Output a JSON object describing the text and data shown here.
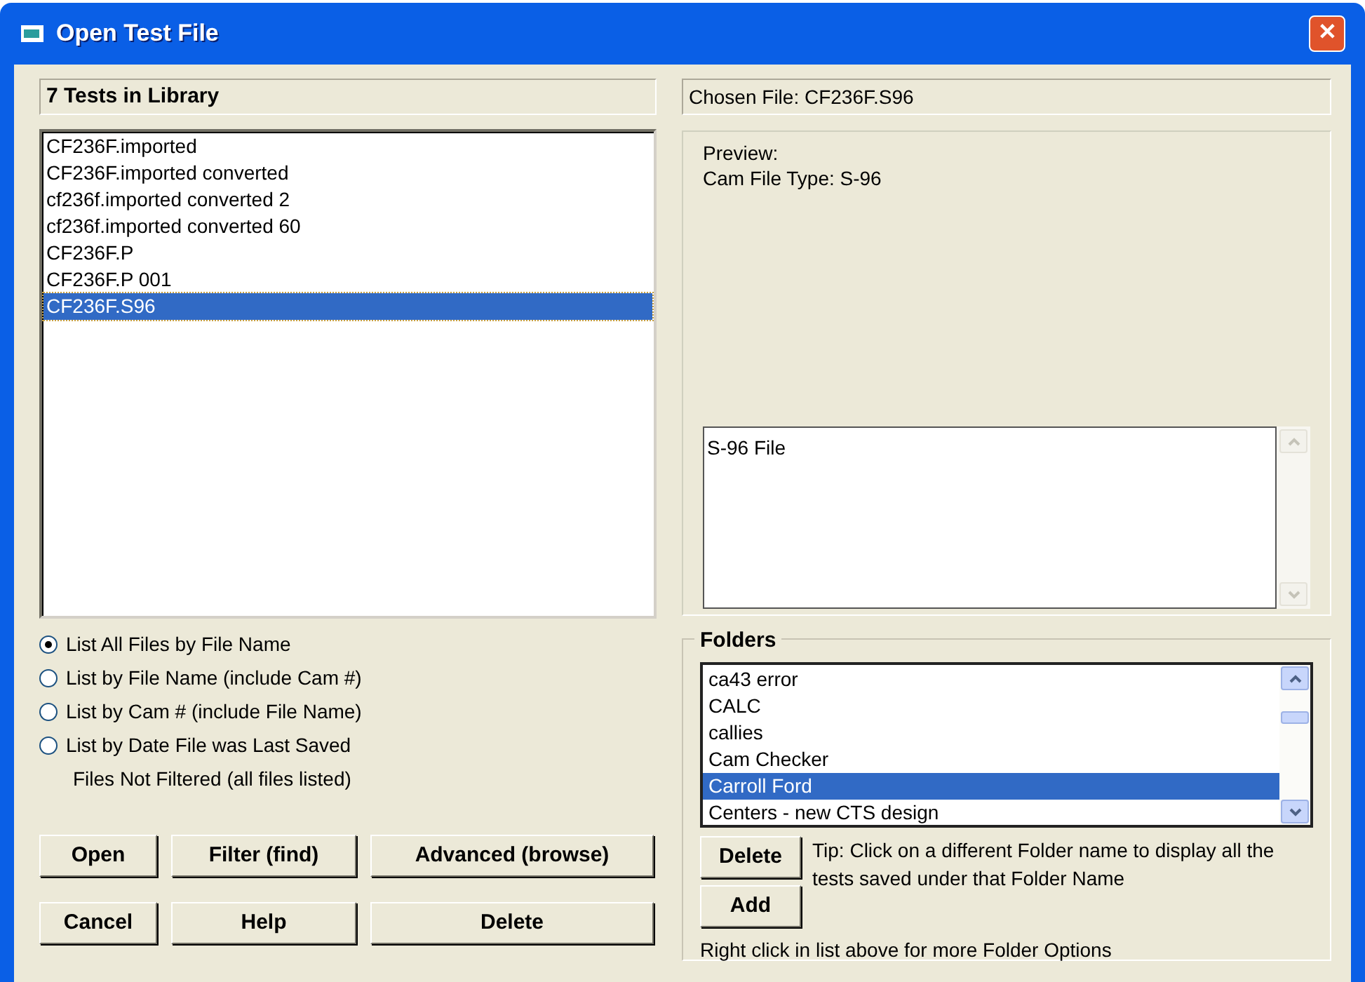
{
  "window": {
    "title": "Open Test File",
    "close": "✕"
  },
  "library": {
    "heading": "7 Tests in Library",
    "files": [
      {
        "name": "CF236F.imported",
        "selected": false
      },
      {
        "name": "CF236F.imported converted",
        "selected": false
      },
      {
        "name": "cf236f.imported converted 2",
        "selected": false
      },
      {
        "name": "cf236f.imported converted 60",
        "selected": false
      },
      {
        "name": "CF236F.P",
        "selected": false
      },
      {
        "name": "CF236F.P 001",
        "selected": false
      },
      {
        "name": "CF236F.S96",
        "selected": true
      }
    ]
  },
  "list_options": [
    {
      "label": "List All Files by File Name",
      "selected": true
    },
    {
      "label": "List by File Name (include Cam #)",
      "selected": false
    },
    {
      "label": "List by Cam # (include File Name)",
      "selected": false
    },
    {
      "label": "List by Date File was Last Saved",
      "selected": false
    }
  ],
  "filter_status": "Files Not Filtered (all files listed)",
  "buttons": [
    [
      "Open",
      "Filter (find)",
      "Advanced (browse)"
    ],
    [
      "Cancel",
      "Help",
      "Delete"
    ]
  ],
  "chosen_file": "Chosen File: CF236F.S96",
  "preview": {
    "lines": [
      "Preview:",
      "Cam File Type: S-96"
    ],
    "text": "S-96 File"
  },
  "folders": {
    "title": "Folders",
    "items": [
      {
        "name": "ca43 error",
        "selected": false
      },
      {
        "name": "CALC",
        "selected": false
      },
      {
        "name": "callies",
        "selected": false
      },
      {
        "name": "Cam Checker",
        "selected": false
      },
      {
        "name": "Carroll Ford",
        "selected": true
      },
      {
        "name": "Centers - new CTS design",
        "selected": false
      }
    ],
    "buttons": [
      "Delete",
      "Add"
    ],
    "tip": "Tip:  Click on a different Folder name to display all the tests saved under that Folder Name",
    "hint": "Right click in list above for more Folder Options"
  }
}
